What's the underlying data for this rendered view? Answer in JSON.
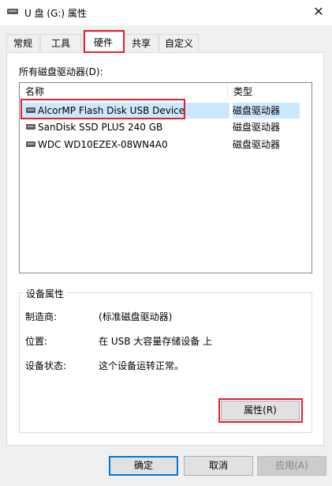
{
  "window": {
    "title": "U 盘 (G:) 属性",
    "icon": "usb-drive-icon"
  },
  "tabs": [
    {
      "label": "常规",
      "selected": false
    },
    {
      "label": "工具",
      "selected": false
    },
    {
      "label": "硬件",
      "selected": true
    },
    {
      "label": "共享",
      "selected": false
    },
    {
      "label": "自定义",
      "selected": false
    }
  ],
  "hardware": {
    "list_label": "所有磁盘驱动器(D):",
    "columns": [
      "名称",
      "类型"
    ],
    "rows": [
      {
        "name": "AlcorMP Flash Disk USB Device",
        "type": "磁盘驱动器",
        "selected": true
      },
      {
        "name": "SanDisk SSD PLUS 240 GB",
        "type": "磁盘驱动器",
        "selected": false
      },
      {
        "name": "WDC WD10EZEX-08WN4A0",
        "type": "磁盘驱动器",
        "selected": false
      }
    ]
  },
  "device_properties": {
    "title": "设备属性",
    "manufacturer_label": "制造商:",
    "manufacturer_value": "(标准磁盘驱动器)",
    "location_label": "位置:",
    "location_value": "在 USB 大容量存储设备 上",
    "status_label": "设备状态:",
    "status_value": "这个设备运转正常。",
    "properties_button": "属性(R)"
  },
  "footer": {
    "ok": "确定",
    "cancel": "取消",
    "apply": "应用(A)"
  },
  "colors": {
    "selection": "#cce8ff",
    "highlight": "#e0222f",
    "accent": "#0078d7"
  }
}
